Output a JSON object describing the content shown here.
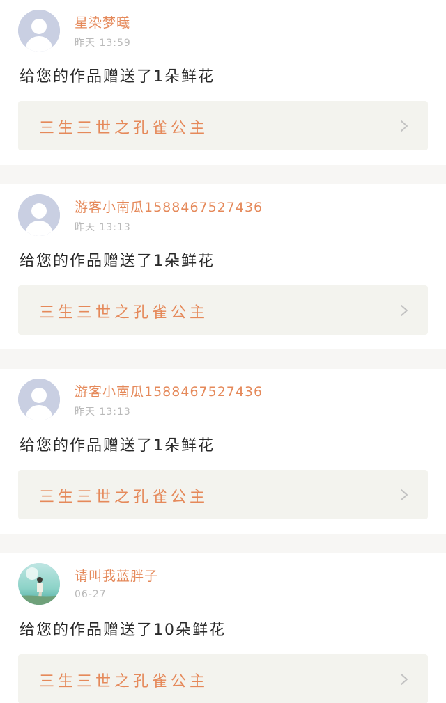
{
  "notifications": [
    {
      "username": "星染梦曦",
      "time": "昨天 13:59",
      "message": "给您的作品赠送了1朵鲜花",
      "book_title": "三生三世之孔雀公主",
      "avatar": "default-avatar-icon"
    },
    {
      "username": "游客小南瓜15884675274​36",
      "time": "昨天 13:13",
      "message": "给您的作品赠送了1朵鲜花",
      "book_title": "三生三世之孔雀公主",
      "avatar": "default-avatar-icon"
    },
    {
      "username": "游客小南瓜15884675274​36",
      "time": "昨天 13:13",
      "message": "给您的作品赠送了1朵鲜花",
      "book_title": "三生三世之孔雀公主",
      "avatar": "default-avatar-icon"
    },
    {
      "username": "请叫我蓝胖子",
      "time": "06-27",
      "message": "给您的作品赠送了10朵鲜花",
      "book_title": "三生三世之孔雀公主",
      "avatar": "photo-avatar"
    }
  ],
  "colors": {
    "accent": "#e5895a",
    "card_bg": "#ffffff",
    "page_bg": "#f7f6f4",
    "book_bg": "#f3f3ee",
    "text": "#2a2a2a",
    "muted": "#b9b9b9"
  }
}
